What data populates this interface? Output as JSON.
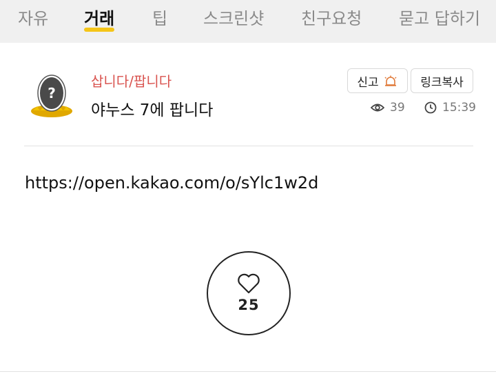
{
  "tabs": [
    {
      "label": "자유"
    },
    {
      "label": "거래"
    },
    {
      "label": "팁"
    },
    {
      "label": "스크린샷"
    },
    {
      "label": "친구요청"
    },
    {
      "label": "묻고 답하기"
    }
  ],
  "active_tab": "거래",
  "colors": {
    "accent_underline": "#f5c518",
    "category": "#d9534f",
    "report_icon": "#e07a3a"
  },
  "post": {
    "category": "삽니다/팝니다",
    "title": "야누스 7에 팝니다",
    "views": "39",
    "time": "15:39",
    "body_link": "https://open.kakao.com/o/sYlc1w2d",
    "likes": "25"
  },
  "actions": {
    "report_label": "신고",
    "copy_link_label": "링크복사"
  },
  "icons": {
    "avatar": "mystery-egg-avatar-icon",
    "report": "siren-icon",
    "views": "eye-icon",
    "time": "clock-icon",
    "like": "heart-icon"
  }
}
